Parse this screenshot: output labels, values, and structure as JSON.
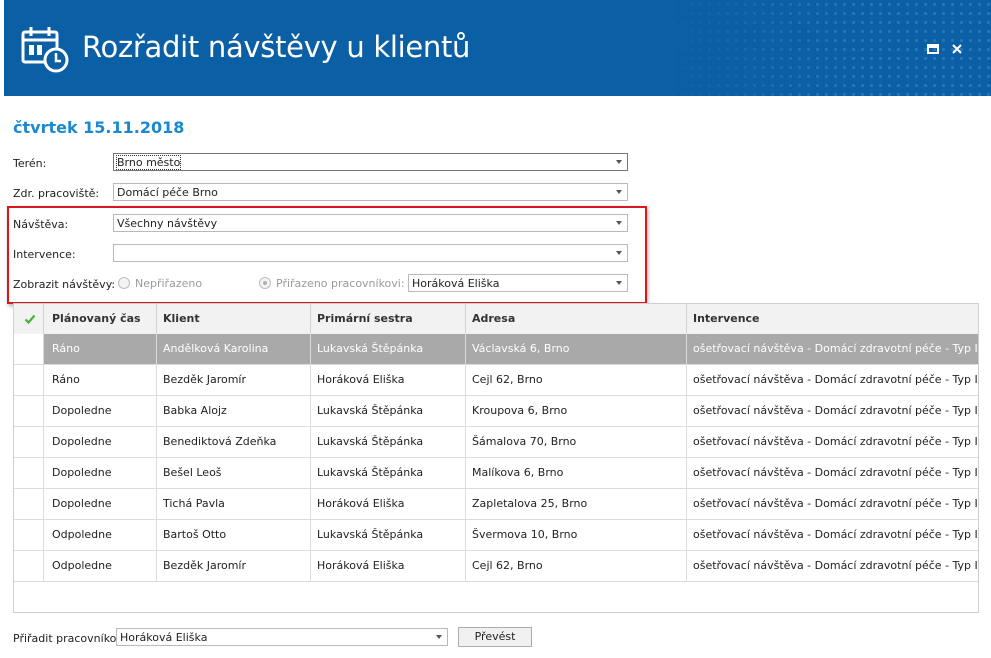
{
  "window": {
    "title": "Rozřadit návštěvy u klientů",
    "icon": "calendar-clock-icon",
    "maximize_icon": "maximize-icon",
    "close_icon": "close-icon",
    "accent_color": "#0b5fa5"
  },
  "date_heading": "čtvrtek 15.11.2018",
  "form": {
    "teren": {
      "label": "Terén:",
      "value": "Brno město"
    },
    "pracoviste": {
      "label": "Zdr. pracoviště:",
      "value": "Domácí péče Brno"
    },
    "navsteva": {
      "label": "Návštěva:",
      "value": "Všechny návštěvy"
    },
    "intervence": {
      "label": "Intervence:",
      "value": ""
    },
    "zobrazit": {
      "label": "Zobrazit návštěvy:",
      "option_unassigned": "Nepřiřazeno",
      "option_assigned": "Přiřazeno pracovníkovi:",
      "selected_option": "Přiřazeno pracovníkovi:",
      "worker": "Horáková Eliška"
    }
  },
  "grid": {
    "columns": [
      "Plánovaný čas",
      "Klient",
      "Primární sestra",
      "Adresa",
      "Intervence"
    ],
    "check_icon": "checkmark-icon",
    "rows": [
      {
        "time": "Ráno",
        "client": "Andělková Karolina",
        "nurse": "Lukavská Štěpánka",
        "address": "Václavská 6, Brno",
        "intervention": "ošetřovací návštěva - Domácí zdravotní péče - Typ IV....",
        "selected": true
      },
      {
        "time": "Ráno",
        "client": "Bezděk Jaromír",
        "nurse": "Horáková Eliška",
        "address": "Cejl 62, Brno",
        "intervention": "ošetřovací návštěva - Domácí zdravotní péče - Typ I.",
        "selected": false
      },
      {
        "time": "Dopoledne",
        "client": "Babka Alojz",
        "nurse": "Lukavská Štěpánka",
        "address": "Kroupova 6, Brno",
        "intervention": "ošetřovací návštěva - Domácí zdravotní péče - Typ II.",
        "selected": false
      },
      {
        "time": "Dopoledne",
        "client": "Benediktová Zdeňka",
        "nurse": "Lukavská Štěpánka",
        "address": "Šámalova 70, Brno",
        "intervention": "ošetřovací návštěva - Domácí zdravotní péče - Typ II....",
        "selected": false
      },
      {
        "time": "Dopoledne",
        "client": "Bešel Leoš",
        "nurse": "Lukavská Štěpánka",
        "address": "Malíkova 6, Brno",
        "intervention": "ošetřovací návštěva - Domácí zdravotní péče - Typ I.",
        "selected": false
      },
      {
        "time": "Dopoledne",
        "client": "Tichá Pavla",
        "nurse": "Horáková Eliška",
        "address": "Zapletalova 25, Brno",
        "intervention": "ošetřovací návštěva - Domácí zdravotní péče - Typ II....",
        "selected": false
      },
      {
        "time": "Odpoledne",
        "client": "Bartoš Otto",
        "nurse": "Lukavská Štěpánka",
        "address": "Švermova 10, Brno",
        "intervention": "ošetřovací návštěva - Domácí zdravotní péče - Typ III....",
        "selected": false
      },
      {
        "time": "Odpoledne",
        "client": "Bezděk Jaromír",
        "nurse": "Horáková Eliška",
        "address": "Cejl 62, Brno",
        "intervention": "ošetřovací návštěva - Domácí zdravotní péče - Typ I.",
        "selected": false
      }
    ]
  },
  "footer": {
    "assign_label": "Přiřadit pracovníkovi:",
    "assign_value": "Horáková Eliška",
    "transfer_button": "Převést"
  }
}
